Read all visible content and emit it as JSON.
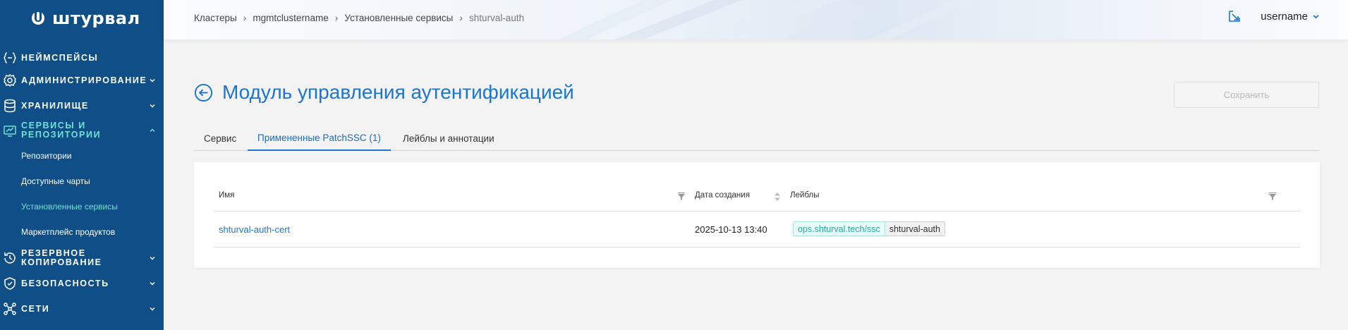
{
  "app": {
    "name": "штурвал"
  },
  "sidebar": {
    "items": [
      {
        "label": "Неймспейсы",
        "icon": "braces-icon"
      },
      {
        "label": "Администрирование",
        "icon": "gear-icon"
      },
      {
        "label": "Хранилище",
        "icon": "database-icon"
      },
      {
        "label": "Сервисы и репозитории",
        "icon": "services-icon",
        "line1": "Сервисы и",
        "line2": "репозитории"
      },
      {
        "label": "Резервное копирование",
        "icon": "backup-icon",
        "line1": "Резервное",
        "line2": "копирование"
      },
      {
        "label": "Безопасность",
        "icon": "shield-icon"
      },
      {
        "label": "Сети",
        "icon": "network-icon"
      }
    ],
    "subitems": [
      {
        "label": "Репозитории"
      },
      {
        "label": "Доступные чарты"
      },
      {
        "label": "Установленные сервисы"
      },
      {
        "label": "Маркетплейс продуктов"
      }
    ],
    "active_color": "#6ee3d6",
    "background": "#0f4e86"
  },
  "breadcrumb": [
    "Кластеры",
    "mgmtclustername",
    "Установленные сервисы",
    "shturval-auth"
  ],
  "header": {
    "username": "username"
  },
  "page": {
    "title": "Модуль управления аутентификацией",
    "save_label": "Сохранить"
  },
  "tabs": [
    {
      "label": "Сервис"
    },
    {
      "label": "Примененные PatchSSC (1)"
    },
    {
      "label": "Лейблы и аннотации"
    }
  ],
  "table": {
    "columns": [
      "Имя",
      "Дата создания",
      "Лейблы"
    ],
    "rows": [
      {
        "name": "shturval-auth-cert",
        "created": "2025-10-13 13:40",
        "label_key": "ops.shturval.tech/ssc",
        "label_value": "shturval-auth"
      }
    ]
  },
  "colors": {
    "accent": "#1a76d2",
    "teal": "#20b0a0"
  }
}
